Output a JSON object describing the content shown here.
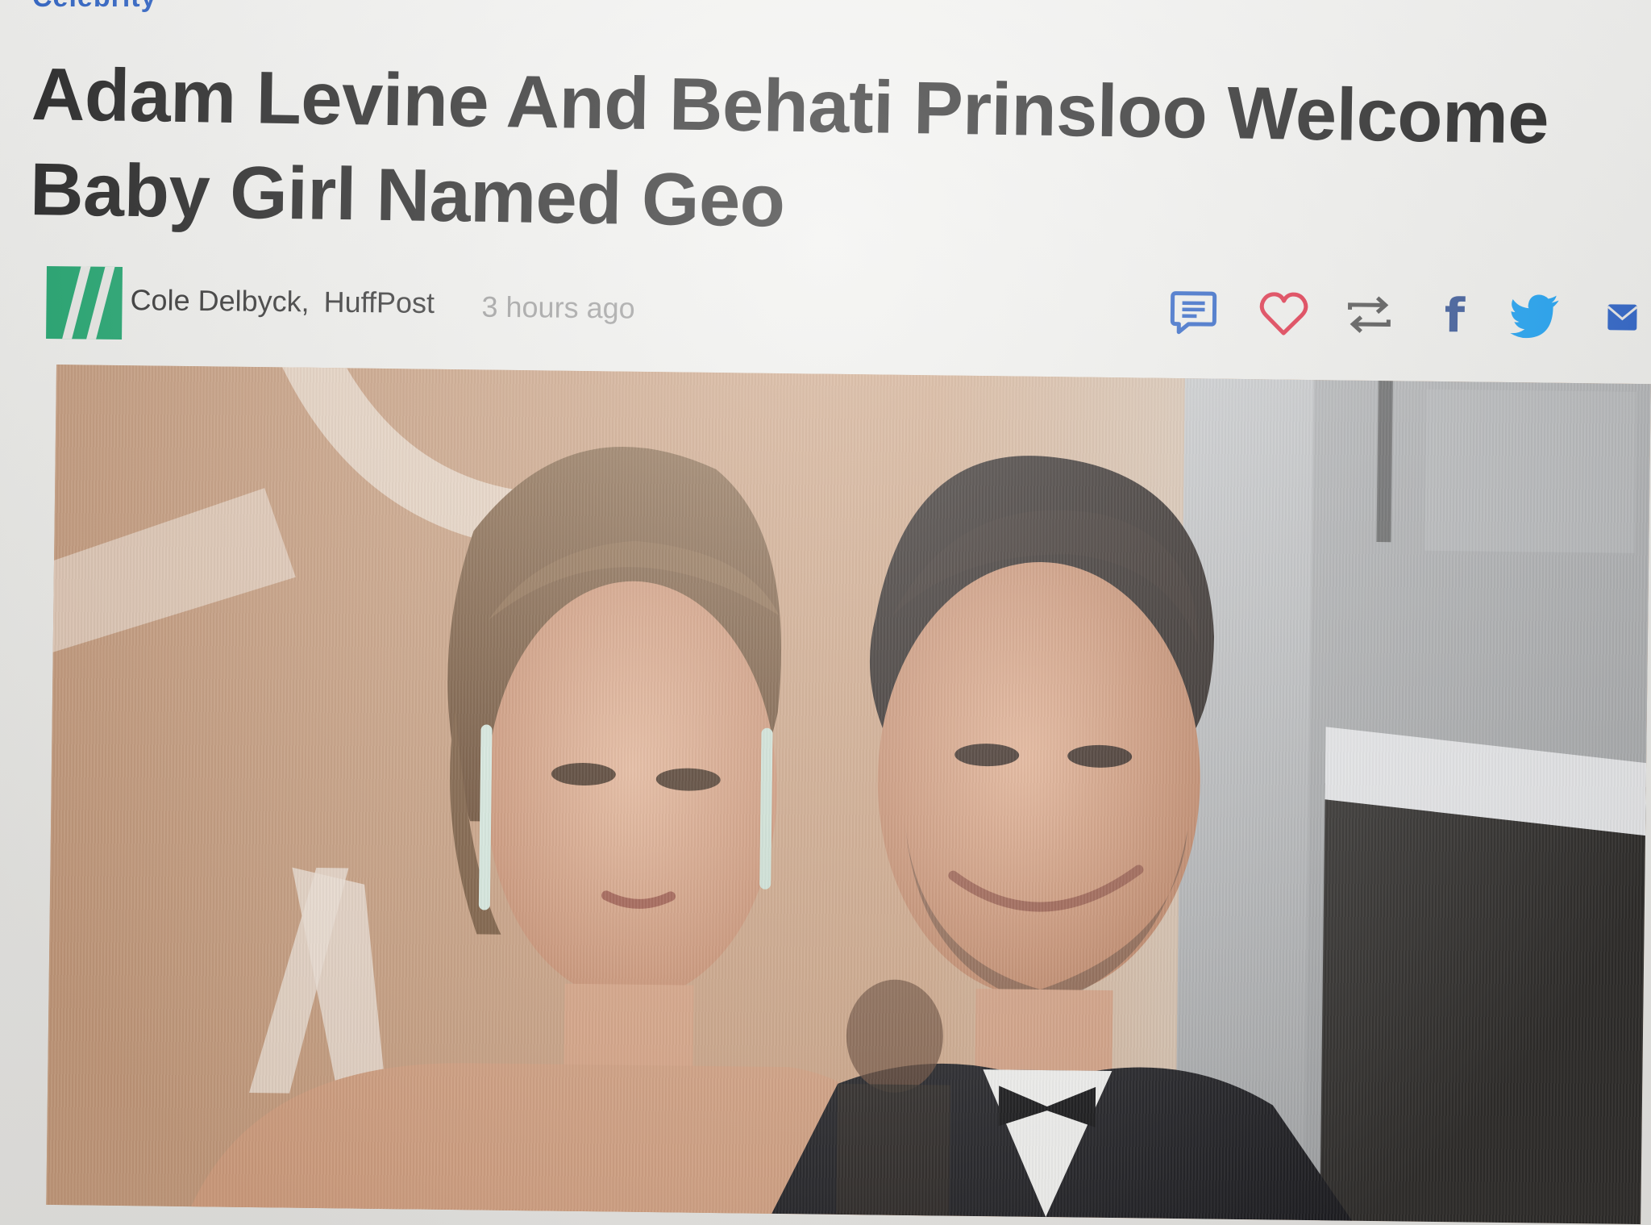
{
  "section": {
    "label": "Celebrity"
  },
  "article": {
    "headline": "Adam Levine And Behati Prinsloo Welcome Baby Girl Named Geo",
    "byline": {
      "author": "Cole Delbyck,",
      "publication": "HuffPost",
      "time": "3 hours ago"
    },
    "brand_color": "#1fa56e"
  },
  "actions": [
    {
      "name": "comment-icon",
      "color": "#2d63c7"
    },
    {
      "name": "heart-icon",
      "color": "#e0334a"
    },
    {
      "name": "share-icon",
      "color": "#555555"
    },
    {
      "name": "facebook-icon",
      "color": "#3b5998"
    },
    {
      "name": "twitter-icon",
      "color": "#1da1f2"
    },
    {
      "name": "email-icon",
      "color": "#2d63c7"
    }
  ],
  "hero_image": {
    "icon": "photo"
  }
}
